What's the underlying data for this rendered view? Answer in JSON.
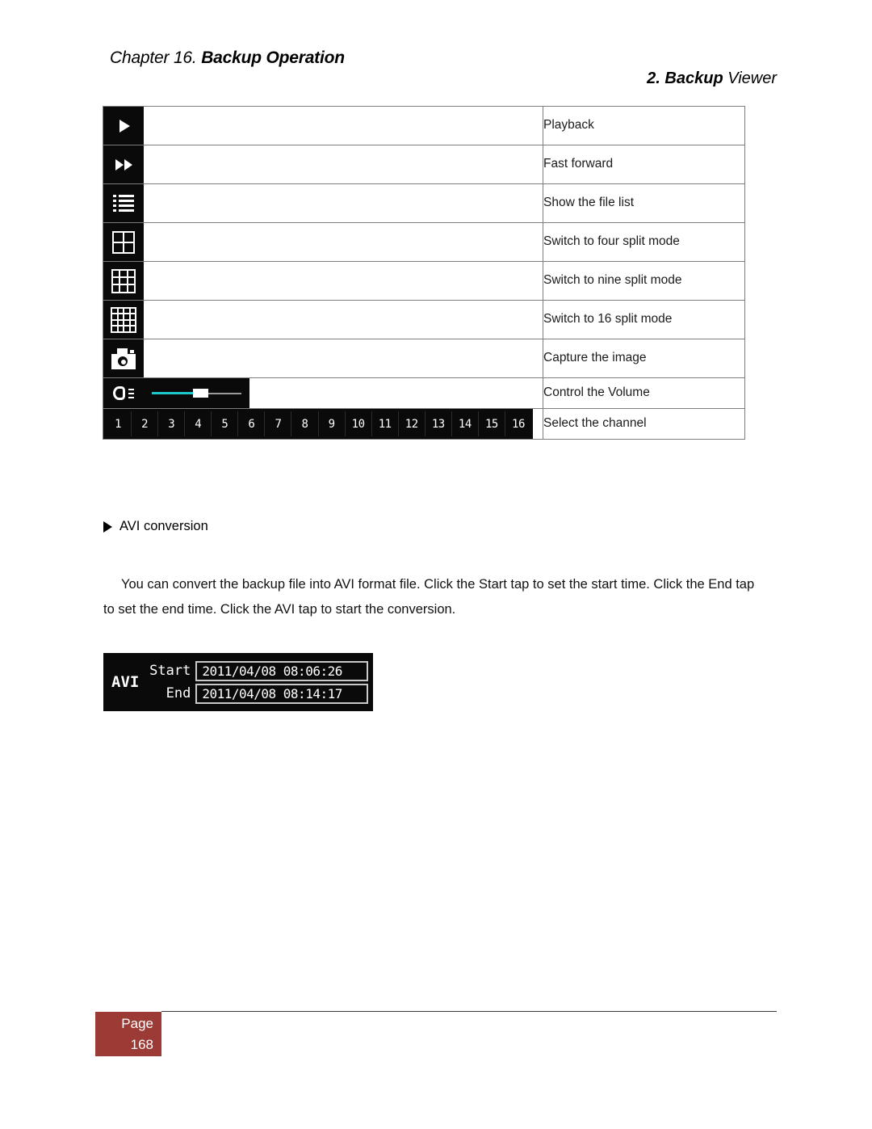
{
  "header": {
    "chapter_prefix": "Chapter 16.",
    "chapter_title": "Backup Operation",
    "section_number": "2. Backup",
    "section_name": "Viewer"
  },
  "icon_table": {
    "rows": [
      {
        "icon": "play-icon",
        "description": "Playback"
      },
      {
        "icon": "fast-forward-icon",
        "description": "Fast forward"
      },
      {
        "icon": "file-list-icon",
        "description": "Show the file list"
      },
      {
        "icon": "four-split-grid-icon",
        "description": "Switch to four split mode"
      },
      {
        "icon": "nine-split-grid-icon",
        "description": "Switch to nine split mode"
      },
      {
        "icon": "sixteen-split-grid-icon",
        "description": "Switch to 16 split mode"
      },
      {
        "icon": "camera-capture-icon",
        "description": "Capture the image"
      },
      {
        "icon": "speaker-volume-icon",
        "description": "Control the Volume"
      },
      {
        "icon": "channel-strip",
        "description": "Select the channel"
      }
    ],
    "volume_slider": {
      "filled_color": "#1ec8c8",
      "track_color": "#9a9a9a",
      "thumb_color": "#ffffff"
    },
    "channels": [
      "1",
      "2",
      "3",
      "4",
      "5",
      "6",
      "7",
      "8",
      "9",
      "10",
      "11",
      "12",
      "13",
      "14",
      "15",
      "16"
    ]
  },
  "avi_section": {
    "bullet_label": "AVI conversion",
    "paragraph": "You can convert the backup file into AVI format file. Click the Start tap to set the start time. Click the End tap to set the end time. Click the AVI tap to start the conversion."
  },
  "avi_panel": {
    "tag": "AVI",
    "start_label": "Start",
    "start_value": "2011/04/08 08:06:26",
    "end_label": "End",
    "end_value": "2011/04/08 08:14:17"
  },
  "footer": {
    "page_word": "Page",
    "page_number": "168",
    "badge_color": "#9C3A35"
  }
}
